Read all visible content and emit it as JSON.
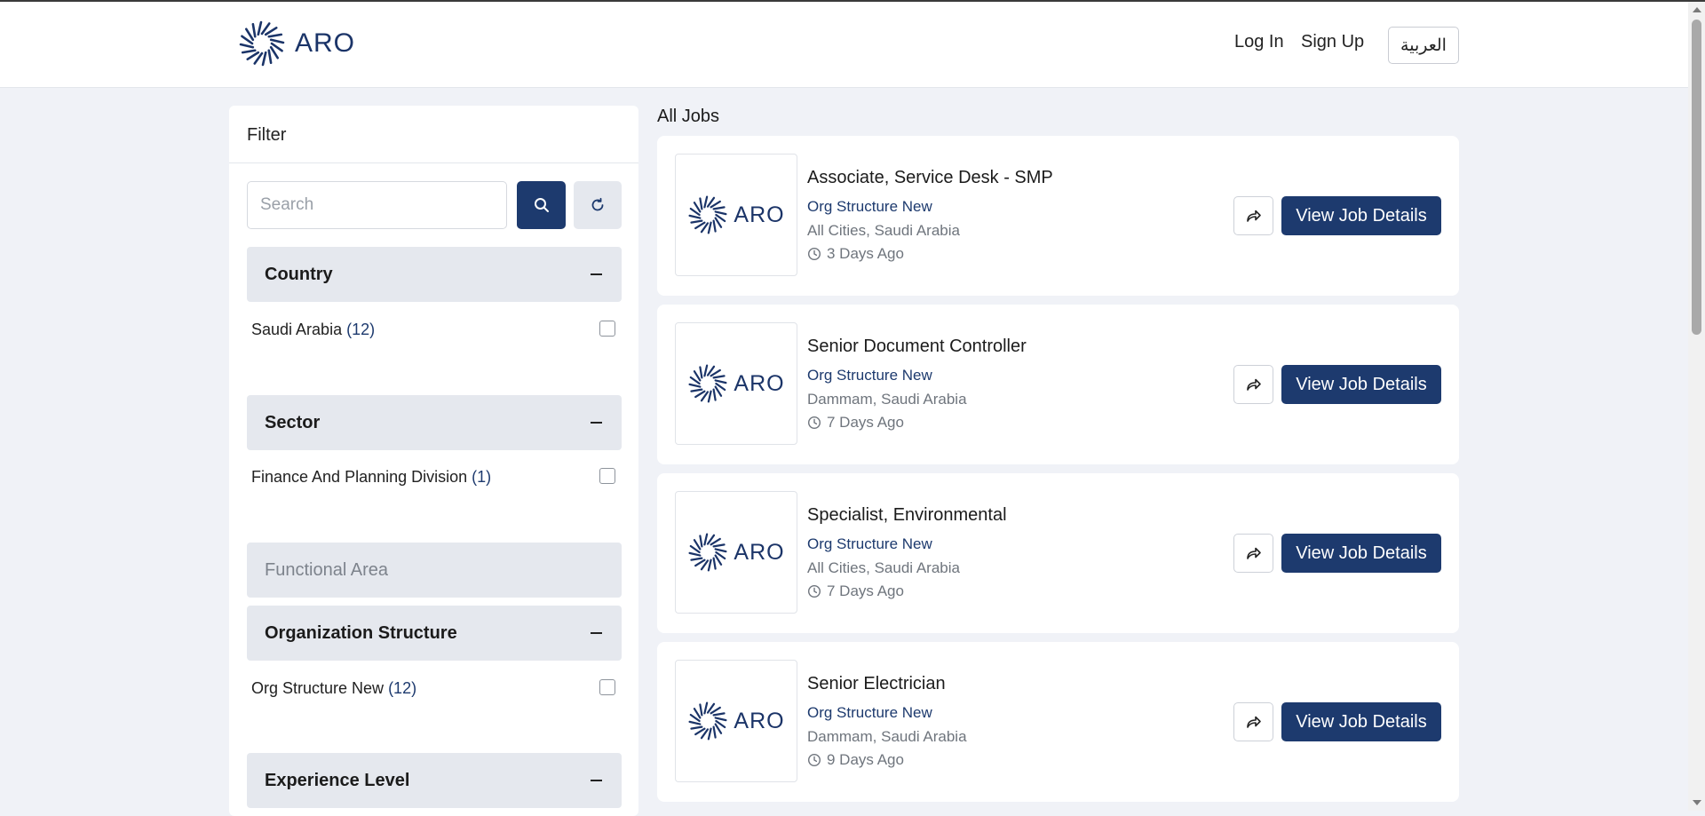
{
  "header": {
    "logo_text": "ARO",
    "login_label": "Log In",
    "signup_label": "Sign Up",
    "language_label": "العربية"
  },
  "filter": {
    "title": "Filter",
    "search_placeholder": "Search",
    "sections": [
      {
        "title": "Country",
        "expanded": true,
        "options": [
          {
            "label": "Saudi Arabia",
            "count": "(12)"
          }
        ]
      },
      {
        "title": "Sector",
        "expanded": true,
        "options": [
          {
            "label": "Finance And Planning Division",
            "count": "(1)"
          }
        ]
      },
      {
        "title": "Functional Area",
        "expanded": false,
        "options": []
      },
      {
        "title": "Organization Structure",
        "expanded": true,
        "options": [
          {
            "label": "Org Structure New",
            "count": "(12)"
          }
        ]
      },
      {
        "title": "Experience Level",
        "expanded": true,
        "options": []
      }
    ]
  },
  "jobs": {
    "title": "All Jobs",
    "view_label": "View Job Details",
    "items": [
      {
        "title": "Associate, Service Desk - SMP",
        "org": "Org Structure New",
        "location": "All Cities, Saudi Arabia",
        "posted": "3 Days Ago"
      },
      {
        "title": "Senior Document Controller",
        "org": "Org Structure New",
        "location": "Dammam, Saudi Arabia",
        "posted": "7 Days Ago"
      },
      {
        "title": "Specialist, Environmental",
        "org": "Org Structure New",
        "location": "All Cities, Saudi Arabia",
        "posted": "7 Days Ago"
      },
      {
        "title": "Senior Electrician",
        "org": "Org Structure New",
        "location": "Dammam, Saudi Arabia",
        "posted": "9 Days Ago"
      }
    ]
  },
  "colors": {
    "brand": "#1d3a6e",
    "page_bg": "#f0f2f7",
    "section_bg": "#e5e8ee"
  },
  "icons": {
    "logo": "aro-burst-icon",
    "search": "search-icon",
    "reset": "refresh-icon",
    "collapse": "minus-icon",
    "share": "share-arrow-icon",
    "time": "clock-icon"
  }
}
